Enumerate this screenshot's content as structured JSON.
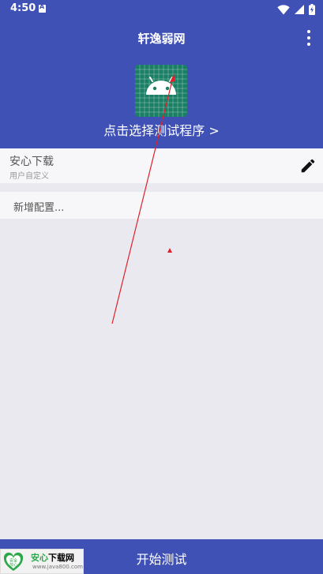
{
  "status_bar": {
    "time": "4:50",
    "icons": [
      "notification-a-icon",
      "wifi-icon",
      "cellular-icon",
      "battery-charging-icon"
    ]
  },
  "header": {
    "title": "轩逸弱网",
    "choose_program_label": "点击选择测试程序 >",
    "app_icon": "android-app-icon"
  },
  "configs": [
    {
      "name": "安心下载",
      "description": "用户自定义",
      "action_icon": "edit-pencil-icon"
    }
  ],
  "add_config_label": "新增配置...",
  "bottom_bar": {
    "start_label": "开始测试"
  },
  "watermark": {
    "title_green": "安心",
    "title_rest": "下载网",
    "url": "www.java800.com",
    "badge_text": [
      "安全",
      "放心"
    ]
  },
  "colors": {
    "primary": "#3f51b5",
    "background": "#eae9f0",
    "row_background": "#f7f7f9",
    "app_icon_green": "#1a7f65",
    "android_green": "#a4c639",
    "annotation_red": "#e0202a"
  }
}
